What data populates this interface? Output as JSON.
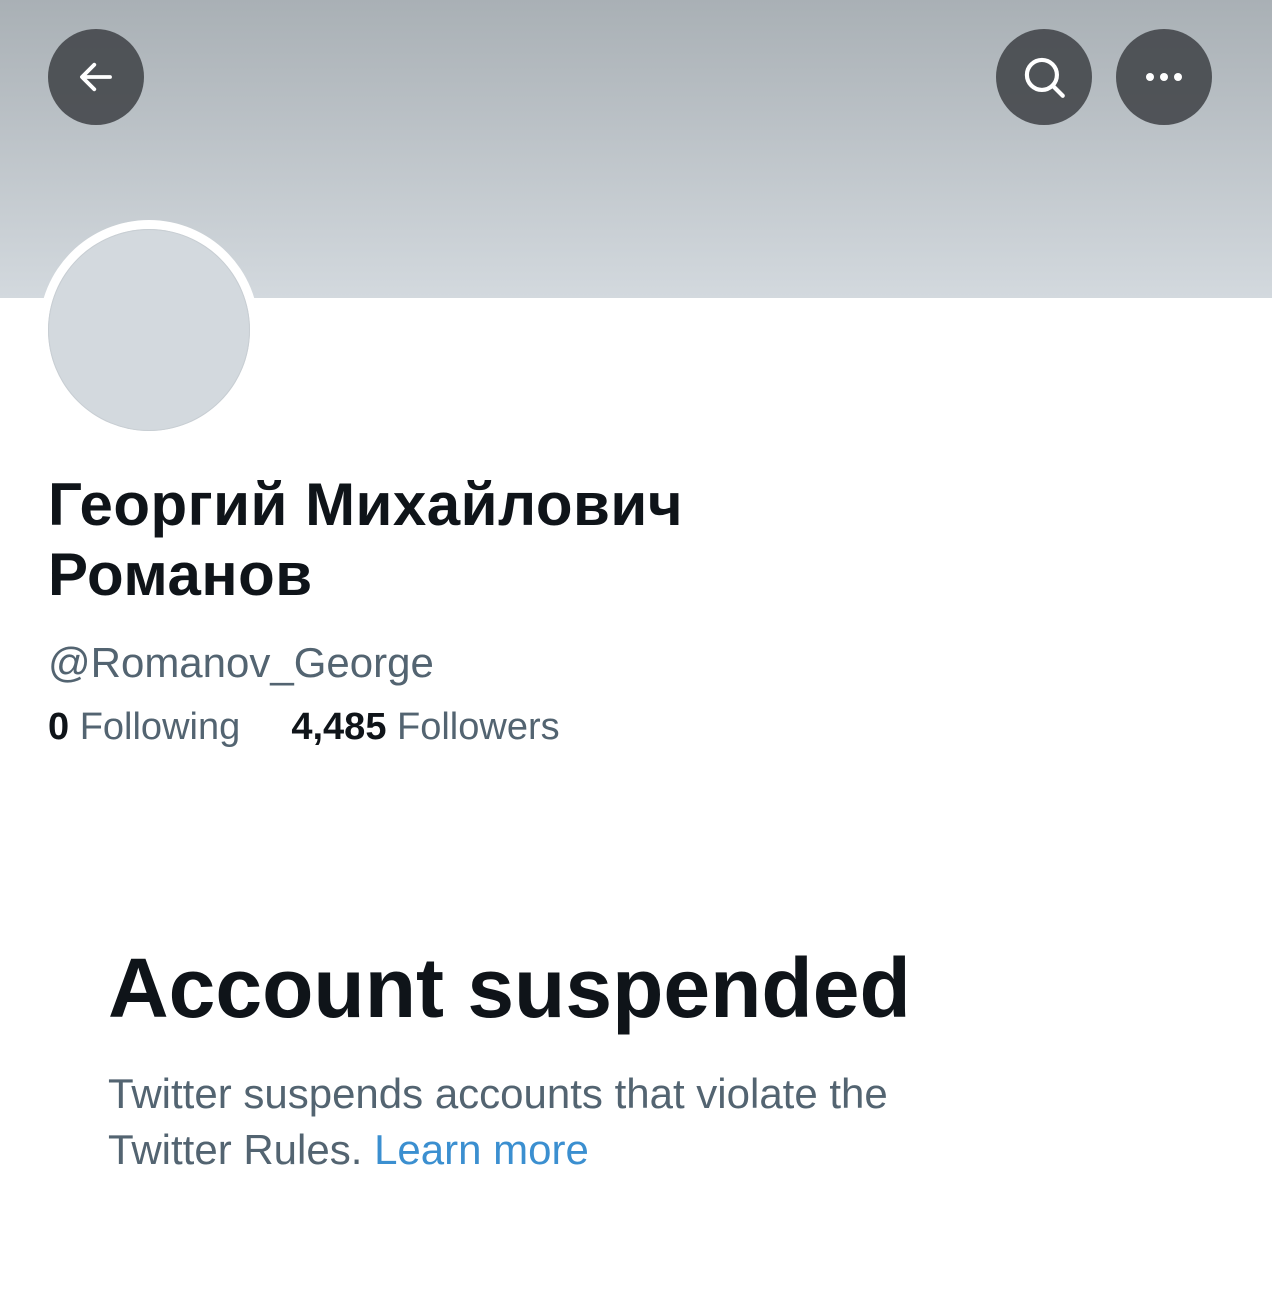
{
  "header": {
    "back_icon": "arrow-left-icon",
    "search_icon": "search-icon",
    "more_icon": "more-horizontal-icon"
  },
  "profile": {
    "name_line1": "Георгий Михайлович",
    "name_line2": "Романов",
    "handle": "@Romanov_George",
    "following_count": "0",
    "following_label": "Following",
    "followers_count": "4,485",
    "followers_label": "Followers"
  },
  "notice": {
    "title": "Account suspended",
    "body_line1": "Twitter suspends accounts that violate the",
    "body_line2": "Twitter Rules.",
    "link_label": "Learn more"
  },
  "colors": {
    "primary_text": "#0f1419",
    "secondary_text": "#536471",
    "link": "#3b8fd0",
    "banner_top": "#a9b0b5",
    "banner_bottom": "#d3d9de"
  }
}
